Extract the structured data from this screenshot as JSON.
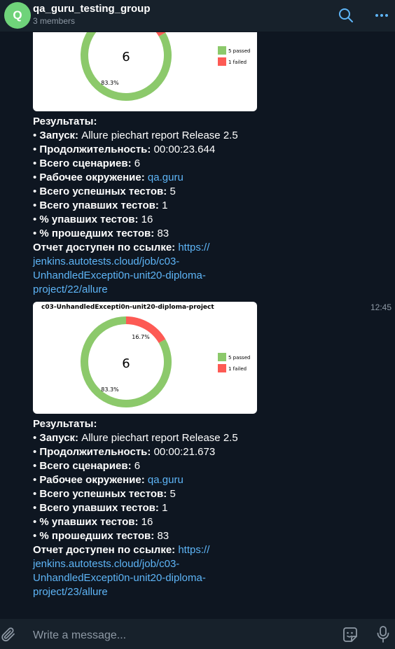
{
  "header": {
    "avatar_letter": "Q",
    "title": "qa_guru_testing_group",
    "subtitle": "3 members",
    "accent": "#5eb5f7"
  },
  "messages": [
    {
      "chart": {
        "title": "",
        "center_label": "6",
        "passed_pct_label": "83.3%",
        "failed_pct_label": "",
        "legend_passed": "5 passed",
        "legend_failed": "1 failed"
      },
      "results_label": "Результаты:",
      "lines": [
        {
          "label": "Запуск:",
          "value": "Allure piechart report Release 2.5"
        },
        {
          "label": "Продолжительность:",
          "value": "00:00:23.644"
        },
        {
          "label": "Всего сценариев:",
          "value": "6"
        },
        {
          "label": "Рабочее окружение:",
          "value": "qa.guru"
        },
        {
          "label": "Всего успешных тестов:",
          "value": "5"
        },
        {
          "label": "Всего упавших тестов:",
          "value": "1"
        },
        {
          "label": "% упавших тестов:",
          "value": "16"
        },
        {
          "label": "% прошедших тестов:",
          "value": "83"
        }
      ],
      "report_label": "Отчет доступен по ссылке:",
      "report_link_1": "https://",
      "report_link_2": "jenkins.autotests.cloud/job/c03-",
      "report_link_3": "UnhandledExcepti0n-unit20-diploma-",
      "report_link_4": "project/22/allure",
      "time": ""
    },
    {
      "chart": {
        "title": "c03-UnhandledExcepti0n-unit20-diploma-project",
        "center_label": "6",
        "passed_pct_label": "83.3%",
        "failed_pct_label": "16.7%",
        "legend_passed": "5 passed",
        "legend_failed": "1 failed"
      },
      "results_label": "Результаты:",
      "lines": [
        {
          "label": "Запуск:",
          "value": "Allure piechart report Release 2.5"
        },
        {
          "label": "Продолжительность:",
          "value": "00:00:21.673"
        },
        {
          "label": "Всего сценариев:",
          "value": "6"
        },
        {
          "label": "Рабочее окружение:",
          "value": "qa.guru"
        },
        {
          "label": "Всего успешных тестов:",
          "value": "5"
        },
        {
          "label": "Всего упавших тестов:",
          "value": "1"
        },
        {
          "label": "% упавших тестов:",
          "value": "16"
        },
        {
          "label": "% прошедших тестов:",
          "value": "83"
        }
      ],
      "report_label": "Отчет доступен по ссылке:",
      "report_link_1": "https://",
      "report_link_2": "jenkins.autotests.cloud/job/c03-",
      "report_link_3": "UnhandledExcepti0n-unit20-diploma-",
      "report_link_4": "project/23/allure",
      "time": "12:45"
    }
  ],
  "chart_data": [
    {
      "type": "pie",
      "categories": [
        "5 passed",
        "1 failed"
      ],
      "values": [
        5,
        1
      ],
      "colors": [
        "#8cc96b",
        "#fd5a54"
      ],
      "title": ""
    },
    {
      "type": "pie",
      "categories": [
        "5 passed",
        "1 failed"
      ],
      "values": [
        5,
        1
      ],
      "colors": [
        "#8cc96b",
        "#fd5a54"
      ],
      "title": "c03-UnhandledExcepti0n-unit20-diploma-project"
    }
  ],
  "input": {
    "placeholder": "Write a message..."
  }
}
